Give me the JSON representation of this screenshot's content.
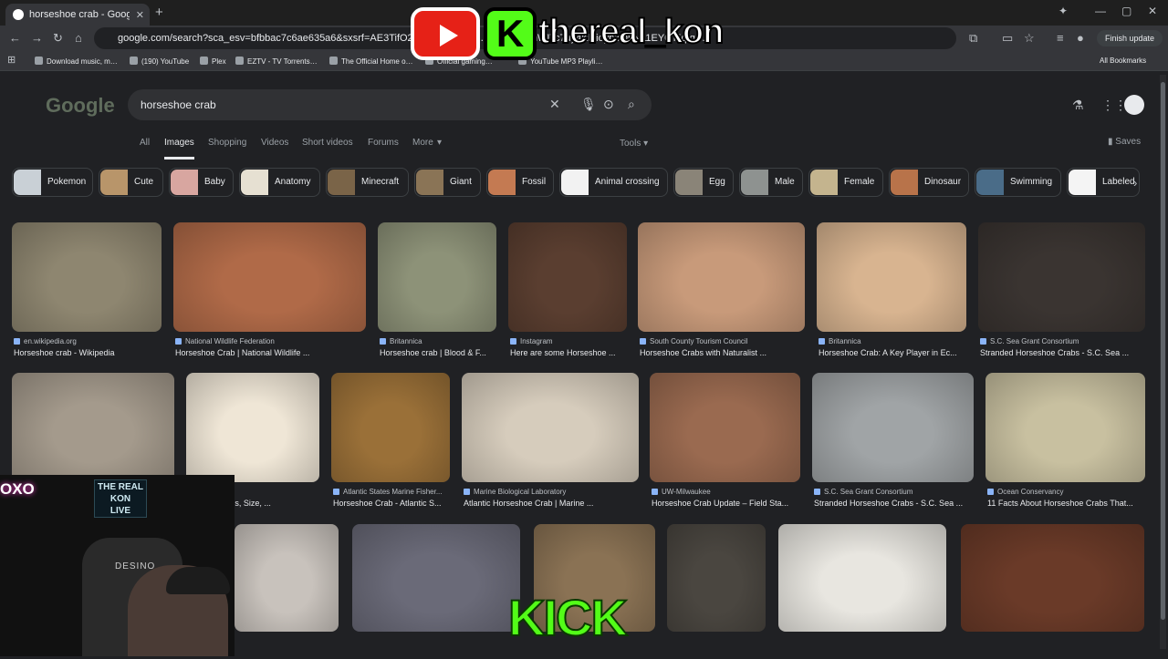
{
  "browser": {
    "tab_title": "horseshoe crab - Google Search",
    "url": "google.com/search?sca_esv=bfbbac7c6ae635a6&sxsrf=AE3TifO2Sk1w7JOAfM…Y6MJ25_tmWITc7uy4Kleioyp3OhN11EY0n5qfq-…",
    "finish_update_label": "Finish update",
    "bookmarks": [
      "Download music, m…",
      "(190) YouTube",
      "Plex",
      "EZTV - TV Torrents…",
      "The Official Home o…",
      "Official gaming…",
      "YouTube MP3 Playli…"
    ],
    "all_bookmarks_label": "All Bookmarks"
  },
  "overlay": {
    "channel_name": "thereal_kon",
    "kick_letter": "K",
    "kick_banner": "KICK",
    "neon_text": "OXO",
    "sign_lines": [
      "THE REAL",
      "KON",
      "LIVE"
    ],
    "chair_brand": "DESINO"
  },
  "google": {
    "logo": "Google",
    "query": "horseshoe crab",
    "tabs": [
      "All",
      "Images",
      "Shopping",
      "Videos",
      "Short videos",
      "Forums",
      "More"
    ],
    "active_tab": "Images",
    "tools_label": "Tools",
    "saves_label": "Saves"
  },
  "chips": [
    {
      "label": "Pokemon",
      "color": "#c9d0d6"
    },
    {
      "label": "Cute",
      "color": "#b8956a"
    },
    {
      "label": "Baby",
      "color": "#d8a6a0"
    },
    {
      "label": "Anatomy",
      "color": "#e6e0d2"
    },
    {
      "label": "Minecraft",
      "color": "#7a6448"
    },
    {
      "label": "Giant",
      "color": "#8a7456"
    },
    {
      "label": "Fossil",
      "color": "#c47a52"
    },
    {
      "label": "Animal crossing",
      "color": "#f2f2f2"
    },
    {
      "label": "Egg",
      "color": "#8a8478"
    },
    {
      "label": "Male",
      "color": "#8e9290"
    },
    {
      "label": "Female",
      "color": "#c4b48e"
    },
    {
      "label": "Dinosaur",
      "color": "#b8734a"
    },
    {
      "label": "Swimming",
      "color": "#4a6c88"
    },
    {
      "label": "Labeled",
      "color": "#f4f4f4"
    }
  ],
  "results_row1": [
    {
      "source": "en.wikipedia.org",
      "title": "Horseshoe crab - Wikipedia",
      "color": "#8e8670"
    },
    {
      "source": "National Wildlife Federation",
      "title": "Horseshoe Crab | National Wildlife ...",
      "color": "#b06a48"
    },
    {
      "source": "Britannica",
      "title": "Horseshoe crab | Blood & F...",
      "color": "#8d9278"
    },
    {
      "source": "Instagram",
      "title": "Here are some Horseshoe ...",
      "color": "#5a3e30"
    },
    {
      "source": "South County Tourism Council",
      "title": "Horseshoe Crabs with Naturalist ...",
      "color": "#c89a7a"
    },
    {
      "source": "Britannica",
      "title": "Horseshoe Crab: A Key Player in Ec...",
      "color": "#d8b490"
    },
    {
      "source": "S.C. Sea Grant Consortium",
      "title": "Stranded Horseshoe Crabs - S.C. Sea ...",
      "color": "#3a3431"
    }
  ],
  "results_row2": [
    {
      "source": "",
      "title": "",
      "color": "#a49a8c"
    },
    {
      "source": "…t.com",
      "title": "Crabs - Types, Size, ...",
      "color": "#efe6d6"
    },
    {
      "source": "Atlantic States Marine Fisher...",
      "title": "Horseshoe Crab - Atlantic S...",
      "color": "#9a7038"
    },
    {
      "source": "Marine Biological Laboratory",
      "title": "Atlantic Horseshoe Crab | Marine ...",
      "color": "#d6ccbc"
    },
    {
      "source": "UW-Milwaukee",
      "title": "Horseshoe Crab Update – Field Sta...",
      "color": "#9a6a50"
    },
    {
      "source": "S.C. Sea Grant Consortium",
      "title": "Stranded Horseshoe Crabs - S.C. Sea ...",
      "color": "#a0a4a6"
    },
    {
      "source": "Ocean Conservancy",
      "title": "11 Facts About Horseshoe Crabs That...",
      "color": "#c8c0a0"
    }
  ],
  "results_row3": [
    {
      "color": "#c8c2bc"
    },
    {
      "color": "#6a6a78"
    },
    {
      "color": "#8a7254"
    },
    {
      "color": "#4a4640"
    },
    {
      "color": "#e8e6e0"
    },
    {
      "color": "#6a3a28"
    }
  ]
}
